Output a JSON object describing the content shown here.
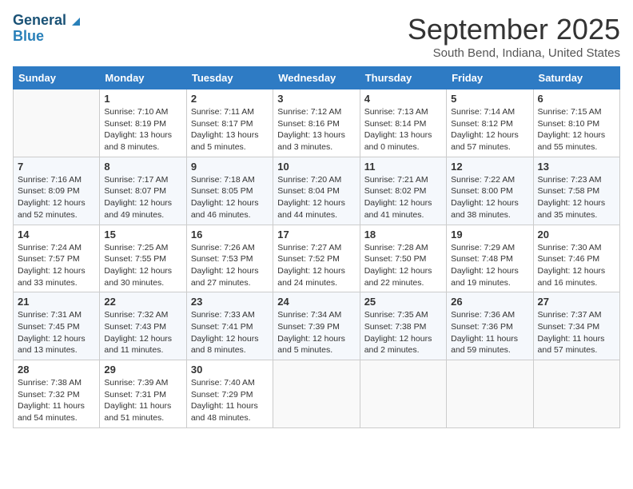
{
  "header": {
    "logo_line1": "General",
    "logo_line2": "Blue",
    "month": "September 2025",
    "location": "South Bend, Indiana, United States"
  },
  "days_of_week": [
    "Sunday",
    "Monday",
    "Tuesday",
    "Wednesday",
    "Thursday",
    "Friday",
    "Saturday"
  ],
  "weeks": [
    [
      {
        "day": "",
        "sunrise": "",
        "sunset": "",
        "daylight": ""
      },
      {
        "day": "1",
        "sunrise": "Sunrise: 7:10 AM",
        "sunset": "Sunset: 8:19 PM",
        "daylight": "Daylight: 13 hours and 8 minutes."
      },
      {
        "day": "2",
        "sunrise": "Sunrise: 7:11 AM",
        "sunset": "Sunset: 8:17 PM",
        "daylight": "Daylight: 13 hours and 5 minutes."
      },
      {
        "day": "3",
        "sunrise": "Sunrise: 7:12 AM",
        "sunset": "Sunset: 8:16 PM",
        "daylight": "Daylight: 13 hours and 3 minutes."
      },
      {
        "day": "4",
        "sunrise": "Sunrise: 7:13 AM",
        "sunset": "Sunset: 8:14 PM",
        "daylight": "Daylight: 13 hours and 0 minutes."
      },
      {
        "day": "5",
        "sunrise": "Sunrise: 7:14 AM",
        "sunset": "Sunset: 8:12 PM",
        "daylight": "Daylight: 12 hours and 57 minutes."
      },
      {
        "day": "6",
        "sunrise": "Sunrise: 7:15 AM",
        "sunset": "Sunset: 8:10 PM",
        "daylight": "Daylight: 12 hours and 55 minutes."
      }
    ],
    [
      {
        "day": "7",
        "sunrise": "Sunrise: 7:16 AM",
        "sunset": "Sunset: 8:09 PM",
        "daylight": "Daylight: 12 hours and 52 minutes."
      },
      {
        "day": "8",
        "sunrise": "Sunrise: 7:17 AM",
        "sunset": "Sunset: 8:07 PM",
        "daylight": "Daylight: 12 hours and 49 minutes."
      },
      {
        "day": "9",
        "sunrise": "Sunrise: 7:18 AM",
        "sunset": "Sunset: 8:05 PM",
        "daylight": "Daylight: 12 hours and 46 minutes."
      },
      {
        "day": "10",
        "sunrise": "Sunrise: 7:20 AM",
        "sunset": "Sunset: 8:04 PM",
        "daylight": "Daylight: 12 hours and 44 minutes."
      },
      {
        "day": "11",
        "sunrise": "Sunrise: 7:21 AM",
        "sunset": "Sunset: 8:02 PM",
        "daylight": "Daylight: 12 hours and 41 minutes."
      },
      {
        "day": "12",
        "sunrise": "Sunrise: 7:22 AM",
        "sunset": "Sunset: 8:00 PM",
        "daylight": "Daylight: 12 hours and 38 minutes."
      },
      {
        "day": "13",
        "sunrise": "Sunrise: 7:23 AM",
        "sunset": "Sunset: 7:58 PM",
        "daylight": "Daylight: 12 hours and 35 minutes."
      }
    ],
    [
      {
        "day": "14",
        "sunrise": "Sunrise: 7:24 AM",
        "sunset": "Sunset: 7:57 PM",
        "daylight": "Daylight: 12 hours and 33 minutes."
      },
      {
        "day": "15",
        "sunrise": "Sunrise: 7:25 AM",
        "sunset": "Sunset: 7:55 PM",
        "daylight": "Daylight: 12 hours and 30 minutes."
      },
      {
        "day": "16",
        "sunrise": "Sunrise: 7:26 AM",
        "sunset": "Sunset: 7:53 PM",
        "daylight": "Daylight: 12 hours and 27 minutes."
      },
      {
        "day": "17",
        "sunrise": "Sunrise: 7:27 AM",
        "sunset": "Sunset: 7:52 PM",
        "daylight": "Daylight: 12 hours and 24 minutes."
      },
      {
        "day": "18",
        "sunrise": "Sunrise: 7:28 AM",
        "sunset": "Sunset: 7:50 PM",
        "daylight": "Daylight: 12 hours and 22 minutes."
      },
      {
        "day": "19",
        "sunrise": "Sunrise: 7:29 AM",
        "sunset": "Sunset: 7:48 PM",
        "daylight": "Daylight: 12 hours and 19 minutes."
      },
      {
        "day": "20",
        "sunrise": "Sunrise: 7:30 AM",
        "sunset": "Sunset: 7:46 PM",
        "daylight": "Daylight: 12 hours and 16 minutes."
      }
    ],
    [
      {
        "day": "21",
        "sunrise": "Sunrise: 7:31 AM",
        "sunset": "Sunset: 7:45 PM",
        "daylight": "Daylight: 12 hours and 13 minutes."
      },
      {
        "day": "22",
        "sunrise": "Sunrise: 7:32 AM",
        "sunset": "Sunset: 7:43 PM",
        "daylight": "Daylight: 12 hours and 11 minutes."
      },
      {
        "day": "23",
        "sunrise": "Sunrise: 7:33 AM",
        "sunset": "Sunset: 7:41 PM",
        "daylight": "Daylight: 12 hours and 8 minutes."
      },
      {
        "day": "24",
        "sunrise": "Sunrise: 7:34 AM",
        "sunset": "Sunset: 7:39 PM",
        "daylight": "Daylight: 12 hours and 5 minutes."
      },
      {
        "day": "25",
        "sunrise": "Sunrise: 7:35 AM",
        "sunset": "Sunset: 7:38 PM",
        "daylight": "Daylight: 12 hours and 2 minutes."
      },
      {
        "day": "26",
        "sunrise": "Sunrise: 7:36 AM",
        "sunset": "Sunset: 7:36 PM",
        "daylight": "Daylight: 11 hours and 59 minutes."
      },
      {
        "day": "27",
        "sunrise": "Sunrise: 7:37 AM",
        "sunset": "Sunset: 7:34 PM",
        "daylight": "Daylight: 11 hours and 57 minutes."
      }
    ],
    [
      {
        "day": "28",
        "sunrise": "Sunrise: 7:38 AM",
        "sunset": "Sunset: 7:32 PM",
        "daylight": "Daylight: 11 hours and 54 minutes."
      },
      {
        "day": "29",
        "sunrise": "Sunrise: 7:39 AM",
        "sunset": "Sunset: 7:31 PM",
        "daylight": "Daylight: 11 hours and 51 minutes."
      },
      {
        "day": "30",
        "sunrise": "Sunrise: 7:40 AM",
        "sunset": "Sunset: 7:29 PM",
        "daylight": "Daylight: 11 hours and 48 minutes."
      },
      {
        "day": "",
        "sunrise": "",
        "sunset": "",
        "daylight": ""
      },
      {
        "day": "",
        "sunrise": "",
        "sunset": "",
        "daylight": ""
      },
      {
        "day": "",
        "sunrise": "",
        "sunset": "",
        "daylight": ""
      },
      {
        "day": "",
        "sunrise": "",
        "sunset": "",
        "daylight": ""
      }
    ]
  ]
}
